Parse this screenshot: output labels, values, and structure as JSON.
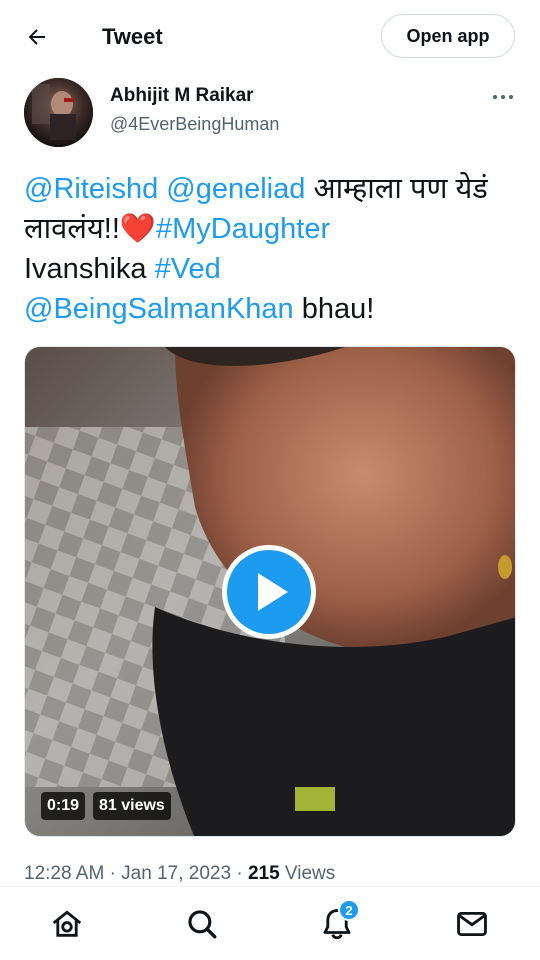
{
  "header": {
    "title": "Tweet",
    "open_app_label": "Open app"
  },
  "author": {
    "name": "Abhijit M Raikar",
    "handle": "@4EverBeingHuman"
  },
  "tweet": {
    "mention_1": "@Riteishd",
    "mention_2": "@geneliad",
    "text_1": "आम्हाला पण येडं लावलंय!!",
    "heart": "❤️",
    "hashtag_1": "#MyDaughter",
    "text_2": "Ivanshika",
    "hashtag_2": "#Ved",
    "mention_3": "@BeingSalmanKhan",
    "text_3": "bhau!"
  },
  "media": {
    "duration": "0:19",
    "views": "81 views"
  },
  "meta": {
    "time": "12:28 AM",
    "date": "Jan 17, 2023",
    "views_count": "215",
    "views_label": "Views"
  },
  "nav": {
    "notification_count": "2"
  },
  "colors": {
    "accent": "#1d9bf0",
    "text": "#0f1419",
    "secondary_text": "#536471"
  },
  "icons": [
    "back-arrow-icon",
    "more-icon",
    "play-icon",
    "home-icon",
    "search-icon",
    "notifications-icon",
    "messages-icon"
  ]
}
